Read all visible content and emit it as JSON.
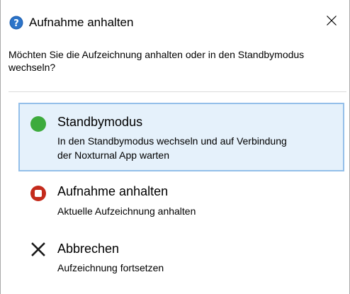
{
  "window": {
    "title": "Aufnahme anhalten",
    "title_icon": "question-icon",
    "close_icon": "close-icon"
  },
  "prompt": "Möchten Sie die Aufzeichnung anhalten oder in den Standbymodus wechseln?",
  "options": [
    {
      "icon": "green-circle-icon",
      "title": "Standbymodus",
      "description": "In den Standbymodus wechseln und auf Verbindung der Noxturnal App warten",
      "selected": true
    },
    {
      "icon": "red-stop-icon",
      "title": "Aufnahme anhalten",
      "description": "Aktuelle Aufzeichnung anhalten",
      "selected": false
    },
    {
      "icon": "x-cancel-icon",
      "title": "Abbrechen",
      "description": "Aufzeichnung fortsetzen",
      "selected": false
    }
  ],
  "colors": {
    "selected_background": "#e5f1fb",
    "selected_border": "#94bfe9",
    "standby_green": "#3dab3d",
    "stop_red": "#c42b1c",
    "question_blue": "#1e5fb0"
  }
}
